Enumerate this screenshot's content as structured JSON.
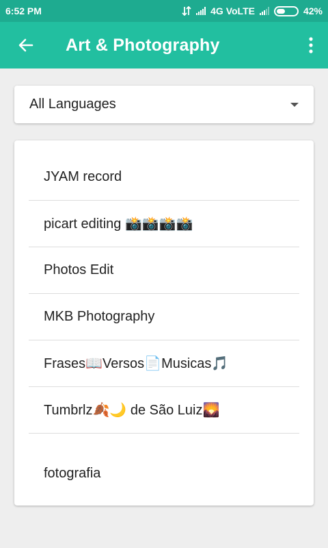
{
  "status_bar": {
    "time": "6:52 PM",
    "network": "4G VoLTE",
    "battery": "42%",
    "battery_level": 0.42
  },
  "app_bar": {
    "title": "Art & Photography",
    "back_icon": "arrow-back-icon",
    "menu_icon": "more-vertical-icon"
  },
  "language_filter": {
    "selected": "All Languages",
    "icon": "dropdown-caret-icon"
  },
  "channels": [
    {
      "label": "JYAM record"
    },
    {
      "label": "picart editing 📸📸📸📸"
    },
    {
      "label": "Photos Edit"
    },
    {
      "label": "MKB Photography"
    },
    {
      "label": "Frases📖Versos📄Musicas🎵"
    },
    {
      "label": "Tumbrlz🍂🌙 de São Luiz🌄"
    },
    {
      "label": "fotografia"
    }
  ],
  "colors": {
    "status_bar": "#1eab90",
    "app_bar": "#22bfa0",
    "background": "#eeeeee"
  }
}
